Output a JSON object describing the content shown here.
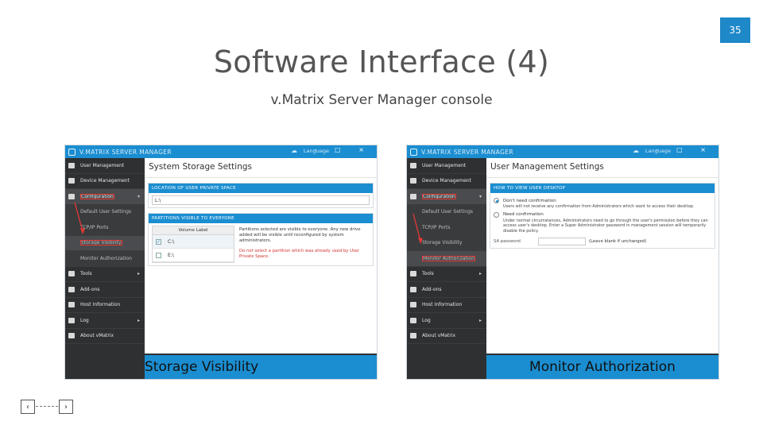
{
  "page_number": "35",
  "title": "Software Interface (4)",
  "subtitle": "v.Matrix Server Manager console",
  "colors": {
    "accent": "#1b8ed1",
    "sidebar": "#2f3032",
    "highlight": "#e53935",
    "page_badge": "#1e88c8"
  },
  "app": {
    "window_title": "V.MATRIX SERVER MANAGER",
    "language_label": "Language",
    "window_buttons": "– □ ×"
  },
  "left_shot": {
    "sidebar": [
      {
        "label": "User Management",
        "icon": "user-icon"
      },
      {
        "label": "Device Management",
        "icon": "device-icon"
      },
      {
        "label": "Configuration",
        "icon": "config-icon"
      },
      {
        "label": "Default User Settings"
      },
      {
        "label": "TCP/IP Ports"
      },
      {
        "label": "Storage Visibility"
      },
      {
        "label": "Monitor Authorization"
      },
      {
        "label": "Tools",
        "icon": "tools-icon"
      },
      {
        "label": "Add-ons",
        "icon": "addons-icon"
      },
      {
        "label": "Host Information",
        "icon": "host-icon"
      },
      {
        "label": "Log",
        "icon": "log-icon"
      },
      {
        "label": "About vMatrix",
        "icon": "about-icon"
      }
    ],
    "heading": "System Storage Settings",
    "location_header": "LOCATION OF USER PRIVATE SPACE",
    "location_value": "L:\\",
    "partitions_header": "PARTITIONS VISIBLE TO EVERYONE",
    "volume_col": "Volume Label",
    "volumes": [
      "C:\\",
      "E:\\"
    ],
    "note": "Partitions selected are visible to everyone. Any new drive added will be visible until reconfigured by system administrators.",
    "warning": "Do not select a partition which was already used by User Private Space.",
    "caption": "Storage Visibility"
  },
  "right_shot": {
    "sidebar": [
      {
        "label": "User Management"
      },
      {
        "label": "Device Management"
      },
      {
        "label": "Configuration"
      },
      {
        "label": "Default User Settings"
      },
      {
        "label": "TCP/IP Ports"
      },
      {
        "label": "Storage Visibility"
      },
      {
        "label": "Monitor Authorization"
      },
      {
        "label": "Tools"
      },
      {
        "label": "Add-ons"
      },
      {
        "label": "Host Information"
      },
      {
        "label": "Log"
      },
      {
        "label": "About vMatrix"
      }
    ],
    "heading": "User Management Settings",
    "section_header": "HOW TO VIEW USER DESKTOP",
    "option1_label": "Don't need confirmation",
    "option1_desc": "Users will not receive any confirmation from Administrators which want to access their desktop.",
    "option2_label": "Need confirmation",
    "option2_desc": "Under normal circumstances, Administrators need to go through the user's permission before they can access user's desktop. Enter a Super Administrator password in management session will temporarily disable the policy.",
    "password_label": "SA password",
    "password_hint": "(Leave blank if unchanged)",
    "caption": "Monitor Authorization"
  },
  "nav": {
    "prev_icon": "chevron-left-icon",
    "next_icon": "chevron-right-icon"
  }
}
